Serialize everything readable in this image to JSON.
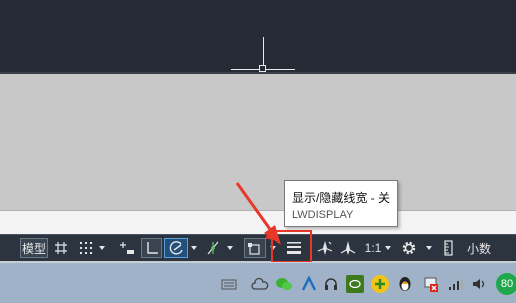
{
  "status_bar": {
    "model_label": "模型",
    "scale_label": "1:1",
    "units_label": "小数"
  },
  "tooltip": {
    "title": "显示/隐藏线宽 - 关",
    "command": "LWDISPLAY"
  },
  "taskbar": {
    "badge_value": "80"
  },
  "colors": {
    "canvas_bg": "#252a34",
    "status_bar_bg": "#2c3440",
    "highlight": "#e8372b",
    "active_blue": "#5aa0e0"
  }
}
